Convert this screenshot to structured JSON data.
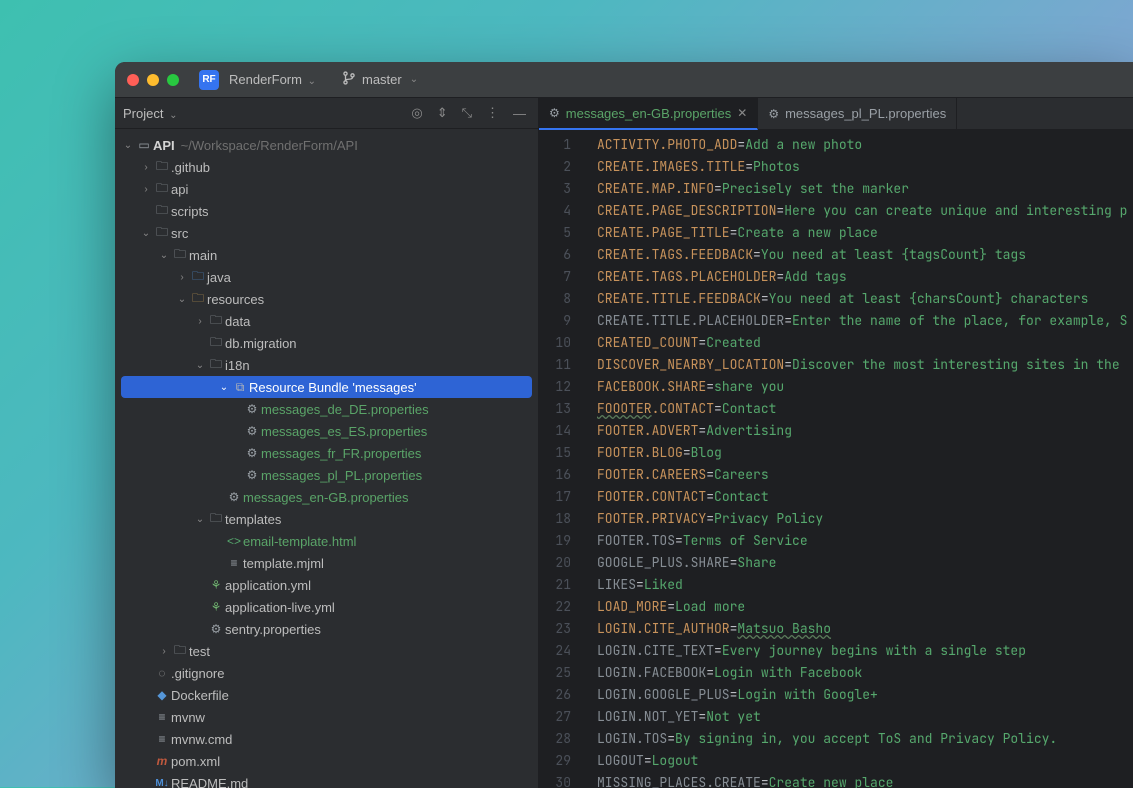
{
  "titlebar": {
    "project_badge": "RF",
    "project_name": "RenderForm",
    "branch": "master"
  },
  "sidebar": {
    "title": "Project",
    "root": {
      "name": "API",
      "path": "~/Workspace/RenderForm/API"
    },
    "nodes": [
      {
        "label": ".github",
        "indent": 1,
        "arrow": "right",
        "icon": "folder"
      },
      {
        "label": "api",
        "indent": 1,
        "arrow": "right",
        "icon": "folder"
      },
      {
        "label": "scripts",
        "indent": 1,
        "arrow": "none",
        "icon": "folder"
      },
      {
        "label": "src",
        "indent": 1,
        "arrow": "down",
        "icon": "folder"
      },
      {
        "label": "main",
        "indent": 2,
        "arrow": "down",
        "icon": "folder"
      },
      {
        "label": "java",
        "indent": 3,
        "arrow": "right",
        "icon": "folder-src"
      },
      {
        "label": "resources",
        "indent": 3,
        "arrow": "down",
        "icon": "folder-res"
      },
      {
        "label": "data",
        "indent": 4,
        "arrow": "right",
        "icon": "folder"
      },
      {
        "label": "db.migration",
        "indent": 4,
        "arrow": "none",
        "icon": "folder"
      },
      {
        "label": "i18n",
        "indent": 4,
        "arrow": "down",
        "icon": "folder"
      },
      {
        "label": "Resource Bundle 'messages'",
        "indent": 5,
        "arrow": "down",
        "icon": "bundle",
        "selected": true
      },
      {
        "label": "messages_de_DE.properties",
        "indent": 6,
        "arrow": "none",
        "icon": "gear",
        "green": true
      },
      {
        "label": "messages_es_ES.properties",
        "indent": 6,
        "arrow": "none",
        "icon": "gear",
        "green": true
      },
      {
        "label": "messages_fr_FR.properties",
        "indent": 6,
        "arrow": "none",
        "icon": "gear",
        "green": true
      },
      {
        "label": "messages_pl_PL.properties",
        "indent": 6,
        "arrow": "none",
        "icon": "gear",
        "green": true
      },
      {
        "label": "messages_en-GB.properties",
        "indent": 5,
        "arrow": "none",
        "icon": "gear",
        "green": true
      },
      {
        "label": "templates",
        "indent": 4,
        "arrow": "down",
        "icon": "folder"
      },
      {
        "label": "email-template.html",
        "indent": 5,
        "arrow": "none",
        "icon": "html",
        "green": true
      },
      {
        "label": "template.mjml",
        "indent": 5,
        "arrow": "none",
        "icon": "file"
      },
      {
        "label": "application.yml",
        "indent": 4,
        "arrow": "none",
        "icon": "yml"
      },
      {
        "label": "application-live.yml",
        "indent": 4,
        "arrow": "none",
        "icon": "yml"
      },
      {
        "label": "sentry.properties",
        "indent": 4,
        "arrow": "none",
        "icon": "gear"
      },
      {
        "label": "test",
        "indent": 2,
        "arrow": "right",
        "icon": "folder"
      },
      {
        "label": ".gitignore",
        "indent": 1,
        "arrow": "none",
        "icon": "gitignore"
      },
      {
        "label": "Dockerfile",
        "indent": 1,
        "arrow": "none",
        "icon": "docker"
      },
      {
        "label": "mvnw",
        "indent": 1,
        "arrow": "none",
        "icon": "file"
      },
      {
        "label": "mvnw.cmd",
        "indent": 1,
        "arrow": "none",
        "icon": "file"
      },
      {
        "label": "pom.xml",
        "indent": 1,
        "arrow": "none",
        "icon": "maven"
      },
      {
        "label": "README.md",
        "indent": 1,
        "arrow": "none",
        "icon": "md"
      }
    ]
  },
  "tabs": [
    {
      "label": "messages_en-GB.properties",
      "active": true
    },
    {
      "label": "messages_pl_PL.properties",
      "active": false
    }
  ],
  "editor": {
    "lines": [
      {
        "n": 1,
        "key": "ACTIVITY.PHOTO_ADD",
        "val": "Add a new photo"
      },
      {
        "n": 2,
        "key": "CREATE.IMAGES.TITLE",
        "val": "Photos"
      },
      {
        "n": 3,
        "key": "CREATE.MAP.INFO",
        "val": "Precisely set the marker"
      },
      {
        "n": 4,
        "key": "CREATE.PAGE_DESCRIPTION",
        "val": "Here you can create unique and interesting p"
      },
      {
        "n": 5,
        "key": "CREATE.PAGE_TITLE",
        "val": "Create a new place"
      },
      {
        "n": 6,
        "key": "CREATE.TAGS.FEEDBACK",
        "val": "You need at least {tagsCount} tags"
      },
      {
        "n": 7,
        "key": "CREATE.TAGS.PLACEHOLDER",
        "val": "Add tags"
      },
      {
        "n": 8,
        "key": "CREATE.TITLE.FEEDBACK",
        "val": "You need at least {charsCount} characters"
      },
      {
        "n": 9,
        "key": "CREATE.TITLE.PLACEHOLDER",
        "greykey": true,
        "val": "Enter the name of the place, for example, S"
      },
      {
        "n": 10,
        "key": "CREATED_COUNT",
        "val": "Created"
      },
      {
        "n": 11,
        "key": "DISCOVER_NEARBY_LOCATION",
        "val": "Discover the most interesting sites in the"
      },
      {
        "n": 12,
        "key": "FACEBOOK.SHARE",
        "val": "share you"
      },
      {
        "n": 13,
        "key_pre": "FOOOTER",
        "key_typo": true,
        "key_post": ".CONTACT",
        "val": "Contact"
      },
      {
        "n": 14,
        "key": "FOOTER.ADVERT",
        "val": "Advertising"
      },
      {
        "n": 15,
        "key": "FOOTER.BLOG",
        "val": "Blog"
      },
      {
        "n": 16,
        "key": "FOOTER.CAREERS",
        "val": "Careers"
      },
      {
        "n": 17,
        "key": "FOOTER.CONTACT",
        "val": "Contact"
      },
      {
        "n": 18,
        "key": "FOOTER.PRIVACY",
        "val": "Privacy Policy"
      },
      {
        "n": 19,
        "key": "FOOTER.TOS",
        "greykey": true,
        "val": "Terms of Service"
      },
      {
        "n": 20,
        "key": "GOOGLE_PLUS.SHARE",
        "greykey": true,
        "val": "Share"
      },
      {
        "n": 21,
        "key": "LIKES",
        "greykey": true,
        "val": "Liked"
      },
      {
        "n": 22,
        "key": "LOAD_MORE",
        "val": "Load more"
      },
      {
        "n": 23,
        "key": "LOGIN.CITE_AUTHOR",
        "val_spell": "Matsuo Basho"
      },
      {
        "n": 24,
        "key": "LOGIN.CITE_TEXT",
        "greykey": true,
        "val": "Every journey begins with a single step"
      },
      {
        "n": 25,
        "key": "LOGIN.FACEBOOK",
        "greykey": true,
        "val": "Login with Facebook"
      },
      {
        "n": 26,
        "key": "LOGIN.GOOGLE_PLUS",
        "greykey": true,
        "val": "Login with Google+"
      },
      {
        "n": 27,
        "key": "LOGIN.NOT_YET",
        "greykey": true,
        "val": "Not yet"
      },
      {
        "n": 28,
        "key": "LOGIN.TOS",
        "greykey": true,
        "val": "By signing in, you accept ToS and Privacy Policy."
      },
      {
        "n": 29,
        "key": "LOGOUT",
        "greykey": true,
        "val": "Logout"
      },
      {
        "n": 30,
        "key": "MISSING_PLACES.CREATE",
        "greykey": true,
        "val_parts": [
          "Create ",
          "new",
          " place"
        ],
        "val_spell_idx": 1
      }
    ]
  }
}
